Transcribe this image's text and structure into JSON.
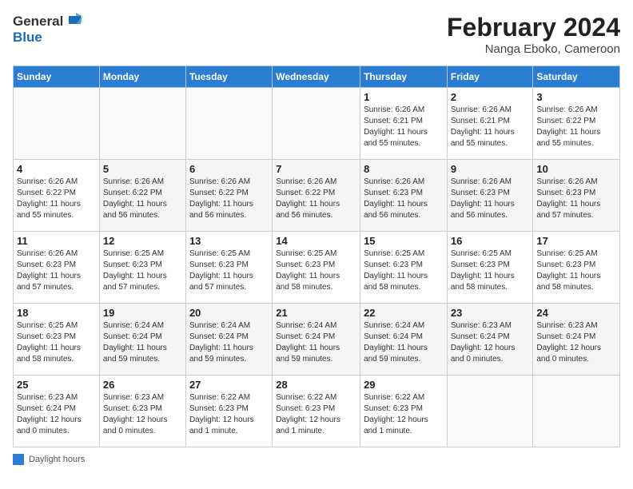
{
  "header": {
    "logo_line1": "General",
    "logo_line2": "Blue",
    "main_title": "February 2024",
    "sub_title": "Nanga Eboko, Cameroon"
  },
  "columns": [
    "Sunday",
    "Monday",
    "Tuesday",
    "Wednesday",
    "Thursday",
    "Friday",
    "Saturday"
  ],
  "weeks": [
    [
      {
        "day": "",
        "info": ""
      },
      {
        "day": "",
        "info": ""
      },
      {
        "day": "",
        "info": ""
      },
      {
        "day": "",
        "info": ""
      },
      {
        "day": "1",
        "info": "Sunrise: 6:26 AM\nSunset: 6:21 PM\nDaylight: 11 hours\nand 55 minutes."
      },
      {
        "day": "2",
        "info": "Sunrise: 6:26 AM\nSunset: 6:21 PM\nDaylight: 11 hours\nand 55 minutes."
      },
      {
        "day": "3",
        "info": "Sunrise: 6:26 AM\nSunset: 6:22 PM\nDaylight: 11 hours\nand 55 minutes."
      }
    ],
    [
      {
        "day": "4",
        "info": "Sunrise: 6:26 AM\nSunset: 6:22 PM\nDaylight: 11 hours\nand 55 minutes."
      },
      {
        "day": "5",
        "info": "Sunrise: 6:26 AM\nSunset: 6:22 PM\nDaylight: 11 hours\nand 56 minutes."
      },
      {
        "day": "6",
        "info": "Sunrise: 6:26 AM\nSunset: 6:22 PM\nDaylight: 11 hours\nand 56 minutes."
      },
      {
        "day": "7",
        "info": "Sunrise: 6:26 AM\nSunset: 6:22 PM\nDaylight: 11 hours\nand 56 minutes."
      },
      {
        "day": "8",
        "info": "Sunrise: 6:26 AM\nSunset: 6:23 PM\nDaylight: 11 hours\nand 56 minutes."
      },
      {
        "day": "9",
        "info": "Sunrise: 6:26 AM\nSunset: 6:23 PM\nDaylight: 11 hours\nand 56 minutes."
      },
      {
        "day": "10",
        "info": "Sunrise: 6:26 AM\nSunset: 6:23 PM\nDaylight: 11 hours\nand 57 minutes."
      }
    ],
    [
      {
        "day": "11",
        "info": "Sunrise: 6:26 AM\nSunset: 6:23 PM\nDaylight: 11 hours\nand 57 minutes."
      },
      {
        "day": "12",
        "info": "Sunrise: 6:25 AM\nSunset: 6:23 PM\nDaylight: 11 hours\nand 57 minutes."
      },
      {
        "day": "13",
        "info": "Sunrise: 6:25 AM\nSunset: 6:23 PM\nDaylight: 11 hours\nand 57 minutes."
      },
      {
        "day": "14",
        "info": "Sunrise: 6:25 AM\nSunset: 6:23 PM\nDaylight: 11 hours\nand 58 minutes."
      },
      {
        "day": "15",
        "info": "Sunrise: 6:25 AM\nSunset: 6:23 PM\nDaylight: 11 hours\nand 58 minutes."
      },
      {
        "day": "16",
        "info": "Sunrise: 6:25 AM\nSunset: 6:23 PM\nDaylight: 11 hours\nand 58 minutes."
      },
      {
        "day": "17",
        "info": "Sunrise: 6:25 AM\nSunset: 6:23 PM\nDaylight: 11 hours\nand 58 minutes."
      }
    ],
    [
      {
        "day": "18",
        "info": "Sunrise: 6:25 AM\nSunset: 6:23 PM\nDaylight: 11 hours\nand 58 minutes."
      },
      {
        "day": "19",
        "info": "Sunrise: 6:24 AM\nSunset: 6:24 PM\nDaylight: 11 hours\nand 59 minutes."
      },
      {
        "day": "20",
        "info": "Sunrise: 6:24 AM\nSunset: 6:24 PM\nDaylight: 11 hours\nand 59 minutes."
      },
      {
        "day": "21",
        "info": "Sunrise: 6:24 AM\nSunset: 6:24 PM\nDaylight: 11 hours\nand 59 minutes."
      },
      {
        "day": "22",
        "info": "Sunrise: 6:24 AM\nSunset: 6:24 PM\nDaylight: 11 hours\nand 59 minutes."
      },
      {
        "day": "23",
        "info": "Sunrise: 6:23 AM\nSunset: 6:24 PM\nDaylight: 12 hours\nand 0 minutes."
      },
      {
        "day": "24",
        "info": "Sunrise: 6:23 AM\nSunset: 6:24 PM\nDaylight: 12 hours\nand 0 minutes."
      }
    ],
    [
      {
        "day": "25",
        "info": "Sunrise: 6:23 AM\nSunset: 6:24 PM\nDaylight: 12 hours\nand 0 minutes."
      },
      {
        "day": "26",
        "info": "Sunrise: 6:23 AM\nSunset: 6:23 PM\nDaylight: 12 hours\nand 0 minutes."
      },
      {
        "day": "27",
        "info": "Sunrise: 6:22 AM\nSunset: 6:23 PM\nDaylight: 12 hours\nand 1 minute."
      },
      {
        "day": "28",
        "info": "Sunrise: 6:22 AM\nSunset: 6:23 PM\nDaylight: 12 hours\nand 1 minute."
      },
      {
        "day": "29",
        "info": "Sunrise: 6:22 AM\nSunset: 6:23 PM\nDaylight: 12 hours\nand 1 minute."
      },
      {
        "day": "",
        "info": ""
      },
      {
        "day": "",
        "info": ""
      }
    ]
  ],
  "legend": {
    "box_label": "Daylight hours"
  }
}
